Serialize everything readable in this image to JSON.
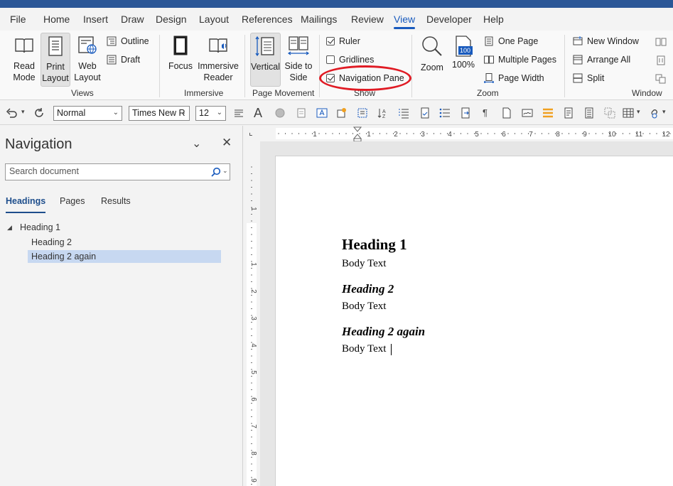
{
  "menu": {
    "tabs": [
      {
        "label": "File"
      },
      {
        "label": "Home"
      },
      {
        "label": "Insert"
      },
      {
        "label": "Draw"
      },
      {
        "label": "Design"
      },
      {
        "label": "Layout"
      },
      {
        "label": "References"
      },
      {
        "label": "Mailings"
      },
      {
        "label": "Review"
      },
      {
        "label": "View",
        "active": true
      },
      {
        "label": "Developer"
      },
      {
        "label": "Help"
      }
    ]
  },
  "ribbon": {
    "views": {
      "group_label": "Views",
      "read_mode": "Read Mode",
      "print_layout": "Print Layout",
      "web_layout": "Web Layout",
      "outline": "Outline",
      "draft": "Draft"
    },
    "immersive": {
      "group_label": "Immersive",
      "focus": "Focus",
      "immersive_reader": "Immersive Reader"
    },
    "page_movement": {
      "group_label": "Page Movement",
      "vertical": "Vertical",
      "side_to_side": "Side to Side"
    },
    "show": {
      "group_label": "Show",
      "ruler": {
        "label": "Ruler",
        "checked": true
      },
      "gridlines": {
        "label": "Gridlines",
        "checked": false
      },
      "navigation_pane": {
        "label": "Navigation Pane",
        "checked": true
      }
    },
    "zoom": {
      "group_label": "Zoom",
      "zoom": "Zoom",
      "hundred": "100%",
      "hundred_icon": "100",
      "one_page": "One Page",
      "multiple_pages": "Multiple Pages",
      "page_width": "Page Width"
    },
    "window": {
      "group_label": "Window",
      "new_window": "New Window",
      "arrange_all": "Arrange All",
      "split": "Split"
    }
  },
  "toolbar": {
    "style": "Normal",
    "font": "Times New R",
    "size": "12"
  },
  "navigation": {
    "title": "Navigation",
    "search_placeholder": "Search document",
    "tabs": [
      {
        "label": "Headings",
        "active": true
      },
      {
        "label": "Pages"
      },
      {
        "label": "Results"
      }
    ],
    "items": [
      {
        "label": "Heading 1",
        "level": 1
      },
      {
        "label": "Heading 2",
        "level": 2
      },
      {
        "label": "Heading 2 again",
        "level": 2,
        "selected": true
      }
    ]
  },
  "ruler": {
    "h_ticks": [
      "1",
      "1",
      "2",
      "3",
      "4",
      "5",
      "6",
      "7",
      "8",
      "9",
      "10",
      "11",
      "12"
    ],
    "v_ticks": [
      "1",
      "1",
      "2",
      "3",
      "4",
      "5",
      "6",
      "7",
      "8",
      "9"
    ]
  },
  "document": {
    "heading1": "Heading 1",
    "body1": "Body Text",
    "heading2": "Heading 2",
    "body2": "Body Text",
    "heading3": "Heading 2 again",
    "body3": "Body Text"
  },
  "colors": {
    "accent": "#185abd",
    "title_bar": "#2b5797",
    "annotation_circle": "#e01b24",
    "nav_selected": "#c7d8f1"
  }
}
